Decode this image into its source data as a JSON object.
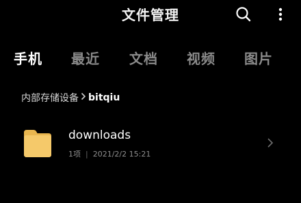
{
  "header": {
    "title": "文件管理",
    "search_icon": "search-icon",
    "more_icon": "more-vertical-icon"
  },
  "tabs": [
    {
      "label": "手机",
      "active": true
    },
    {
      "label": "最近",
      "active": false
    },
    {
      "label": "文档",
      "active": false
    },
    {
      "label": "视频",
      "active": false
    },
    {
      "label": "图片",
      "active": false
    }
  ],
  "breadcrumb": {
    "root": "内部存储设备",
    "separator_icon": "chevron-right-icon",
    "current": "bitqiu"
  },
  "files": [
    {
      "name": "downloads",
      "count": "1项",
      "separator": "|",
      "modified": "2021/2/2 15:21",
      "icon": "folder-icon"
    }
  ],
  "colors": {
    "background": "#000000",
    "folder": "#F5C96A",
    "active_tab": "#FFFFFF",
    "inactive_tab": "#8A8A8A"
  }
}
